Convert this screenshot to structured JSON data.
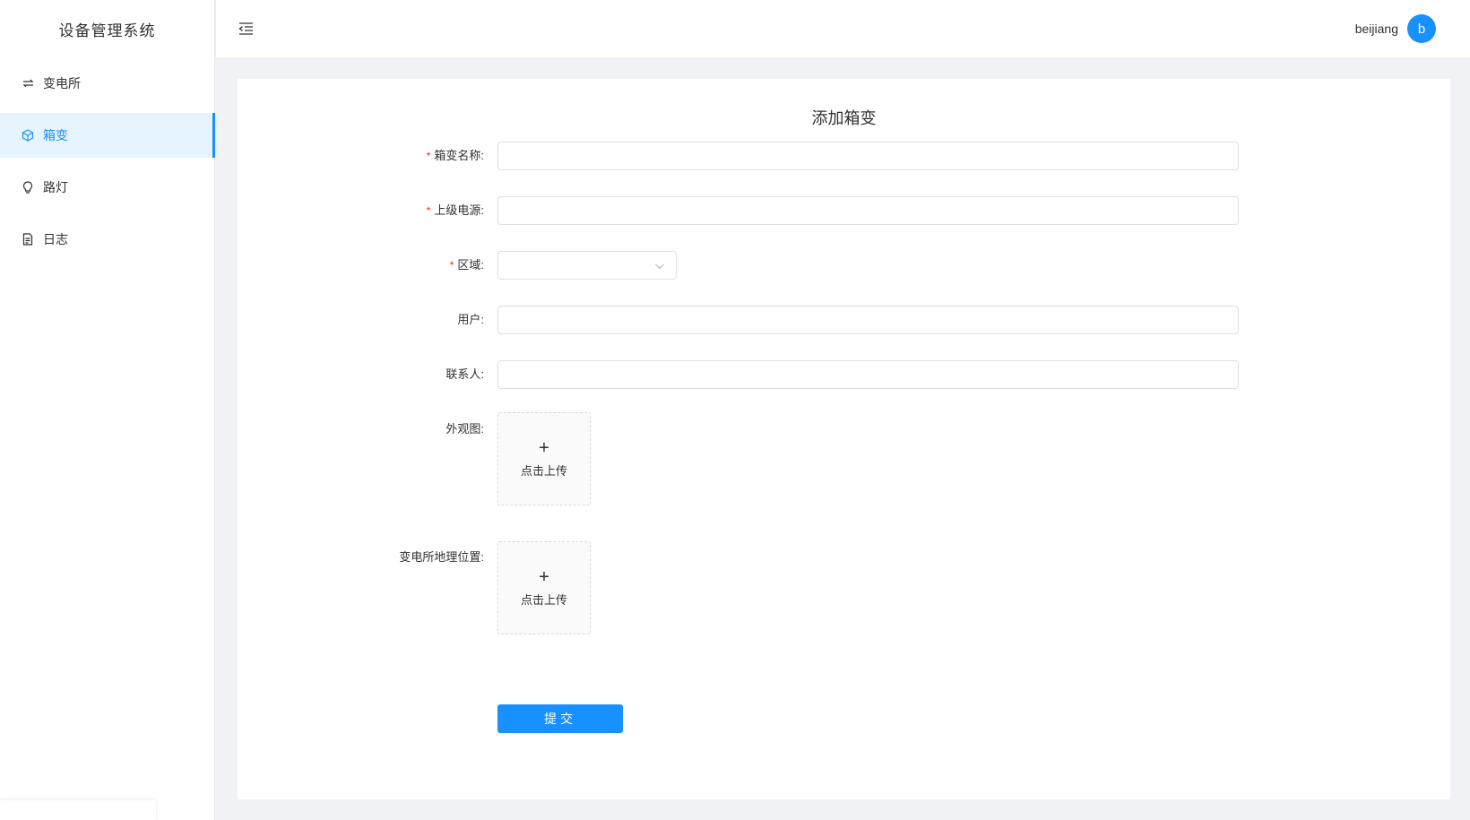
{
  "app": {
    "title": "设备管理系统"
  },
  "sidebar": {
    "items": [
      {
        "label": "变电所",
        "icon": "swap-icon",
        "active": false
      },
      {
        "label": "箱变",
        "icon": "cube-icon",
        "active": true
      },
      {
        "label": "路灯",
        "icon": "bulb-icon",
        "active": false
      },
      {
        "label": "日志",
        "icon": "file-icon",
        "active": false
      }
    ]
  },
  "header": {
    "toggle_icon": "menu-fold-icon",
    "username": "beijiang",
    "avatar_letter": "b"
  },
  "form": {
    "title": "添加箱变",
    "fields": {
      "name": {
        "label": "箱变名称:",
        "required": true,
        "value": ""
      },
      "power": {
        "label": "上级电源:",
        "required": true,
        "value": ""
      },
      "region": {
        "label": "区域:",
        "required": true,
        "value": ""
      },
      "user": {
        "label": "用户:",
        "required": false,
        "value": ""
      },
      "contact": {
        "label": "联系人:",
        "required": false,
        "value": ""
      },
      "appearance": {
        "label": "外观图:",
        "upload_text": "点击上传"
      },
      "location": {
        "label": "变电所地理位置:",
        "upload_text": "点击上传"
      }
    },
    "required_mark": "*",
    "submit_label": "提交"
  },
  "colors": {
    "primary": "#1890ff",
    "required": "#f5222d",
    "bg": "#f0f2f5"
  }
}
